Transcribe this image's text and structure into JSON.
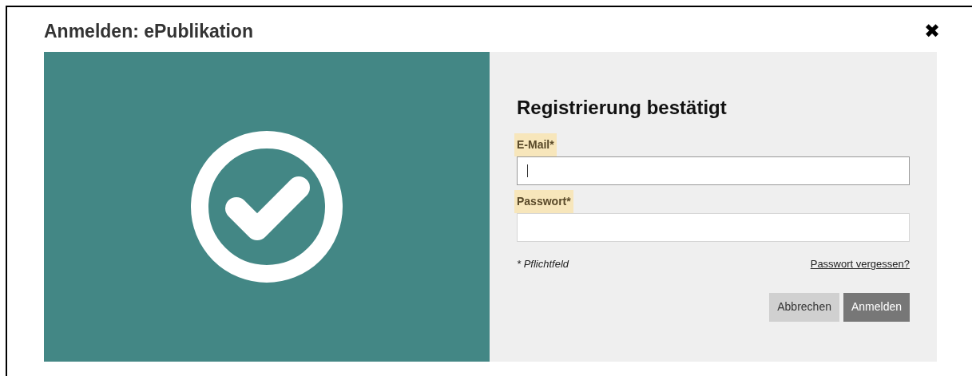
{
  "dialog": {
    "title": "Anmelden: ePublikation",
    "close": "✖"
  },
  "form": {
    "heading": "Registrierung bestätigt",
    "fields": [
      {
        "label": "E-Mail*",
        "highlighted": true,
        "focused": true
      },
      {
        "label": "Passwort*",
        "highlighted": true,
        "focused": false
      }
    ],
    "required_note": "* Pflichtfeld",
    "forgot_link": "Passwort vergessen?",
    "buttons": [
      {
        "label": "Abbrechen",
        "kind": "secondary"
      },
      {
        "label": "Anmelden",
        "kind": "primary"
      }
    ]
  }
}
